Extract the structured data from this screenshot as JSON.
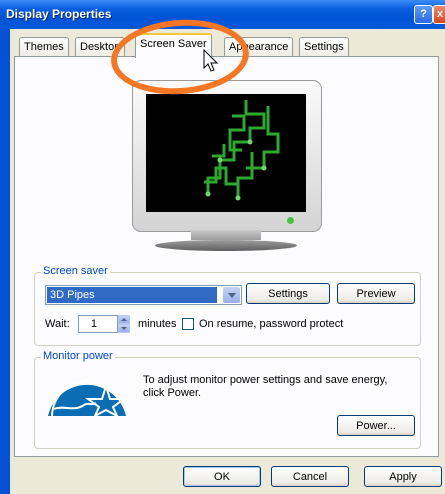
{
  "window": {
    "title": "Display Properties",
    "help_label": "?",
    "close_label": "x"
  },
  "tabs": [
    {
      "label": "Themes",
      "active": false
    },
    {
      "label": "Desktop",
      "active": false
    },
    {
      "label": "Screen Saver",
      "active": true
    },
    {
      "label": "Appearance",
      "active": false
    },
    {
      "label": "Settings",
      "active": false
    }
  ],
  "screen_saver": {
    "group_label": "Screen saver",
    "selected": "3D Pipes",
    "settings_label": "Settings",
    "preview_label": "Preview",
    "wait_label": "Wait:",
    "wait_value": "1",
    "minutes_label": "minutes",
    "resume_label": "On resume, password protect",
    "resume_checked": false
  },
  "monitor_power": {
    "group_label": "Monitor power",
    "description": "To adjust monitor power settings and save energy, click Power.",
    "power_label": "Power..."
  },
  "footer": {
    "ok_label": "OK",
    "cancel_label": "Cancel",
    "apply_label": "Apply"
  },
  "colors": {
    "title_bar": "#0053D6",
    "annotation_circle": "#F57623",
    "pipes": "#2EA82E",
    "selection": "#316AC5"
  },
  "icons": {
    "energy_star": "energy-star-icon",
    "cursor": "arrow-cursor-icon"
  }
}
